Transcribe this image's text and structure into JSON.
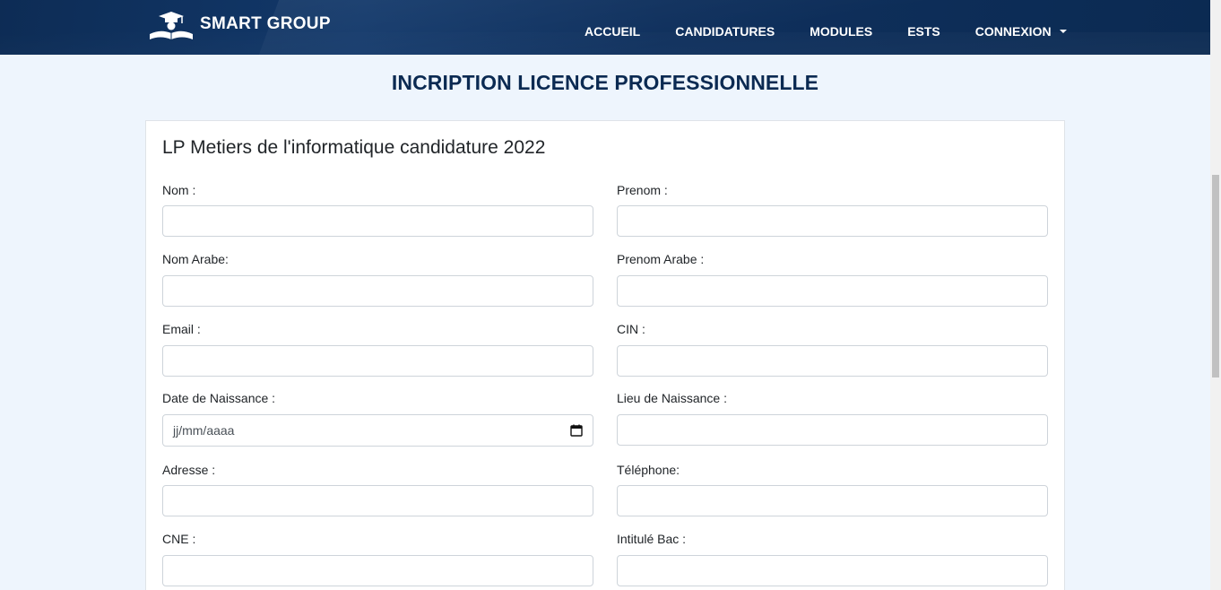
{
  "brand": {
    "name": "SMART GROUP",
    "logo_icon": "graduation-cap-book-icon"
  },
  "nav": {
    "items": [
      {
        "label": "ACCUEIL"
      },
      {
        "label": "CANDIDATURES"
      },
      {
        "label": "MODULES"
      },
      {
        "label": "ESTS"
      },
      {
        "label": "CONNEXION",
        "dropdown": true
      }
    ]
  },
  "page": {
    "title": "INCRIPTION LICENCE PROFESSIONNELLE"
  },
  "form": {
    "title": "LP Metiers de l'informatique candidature 2022",
    "fields": {
      "nom": {
        "label": "Nom :",
        "value": ""
      },
      "prenom": {
        "label": "Prenom :",
        "value": ""
      },
      "nom_arabe": {
        "label": "Nom Arabe:",
        "value": ""
      },
      "prenom_arabe": {
        "label": "Prenom Arabe :",
        "value": ""
      },
      "email": {
        "label": "Email :",
        "value": ""
      },
      "cin": {
        "label": "CIN :",
        "value": ""
      },
      "date_naissance": {
        "label": "Date de Naissance :",
        "placeholder": "jj/mm/aaaa",
        "icon": "calendar-icon"
      },
      "lieu_naissance": {
        "label": "Lieu de Naissance :",
        "value": ""
      },
      "adresse": {
        "label": "Adresse :",
        "value": ""
      },
      "telephone": {
        "label": "Téléphone:",
        "value": ""
      },
      "cne": {
        "label": "CNE :",
        "value": ""
      },
      "intitule_bac": {
        "label": "Intitulé Bac :",
        "value": ""
      }
    }
  },
  "colors": {
    "navbar": "#0d2c55",
    "title": "#0b2a52",
    "background": "#eef5fd"
  }
}
